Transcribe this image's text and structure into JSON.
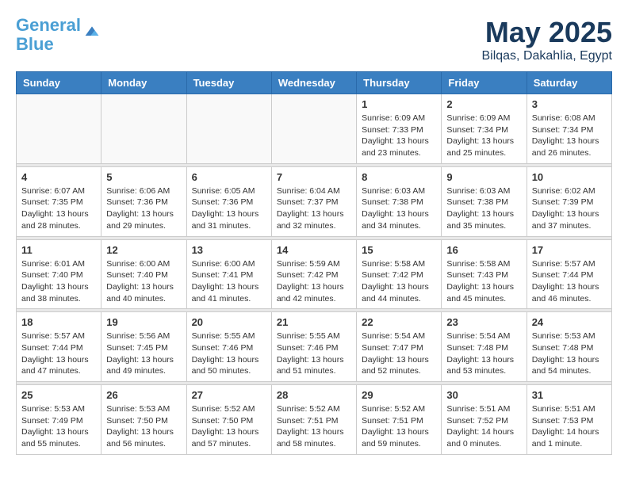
{
  "header": {
    "logo_line1": "General",
    "logo_line2": "Blue",
    "month": "May 2025",
    "location": "Bilqas, Dakahlia, Egypt"
  },
  "days_of_week": [
    "Sunday",
    "Monday",
    "Tuesday",
    "Wednesday",
    "Thursday",
    "Friday",
    "Saturday"
  ],
  "weeks": [
    [
      {
        "num": "",
        "info": ""
      },
      {
        "num": "",
        "info": ""
      },
      {
        "num": "",
        "info": ""
      },
      {
        "num": "",
        "info": ""
      },
      {
        "num": "1",
        "info": "Sunrise: 6:09 AM\nSunset: 7:33 PM\nDaylight: 13 hours\nand 23 minutes."
      },
      {
        "num": "2",
        "info": "Sunrise: 6:09 AM\nSunset: 7:34 PM\nDaylight: 13 hours\nand 25 minutes."
      },
      {
        "num": "3",
        "info": "Sunrise: 6:08 AM\nSunset: 7:34 PM\nDaylight: 13 hours\nand 26 minutes."
      }
    ],
    [
      {
        "num": "4",
        "info": "Sunrise: 6:07 AM\nSunset: 7:35 PM\nDaylight: 13 hours\nand 28 minutes."
      },
      {
        "num": "5",
        "info": "Sunrise: 6:06 AM\nSunset: 7:36 PM\nDaylight: 13 hours\nand 29 minutes."
      },
      {
        "num": "6",
        "info": "Sunrise: 6:05 AM\nSunset: 7:36 PM\nDaylight: 13 hours\nand 31 minutes."
      },
      {
        "num": "7",
        "info": "Sunrise: 6:04 AM\nSunset: 7:37 PM\nDaylight: 13 hours\nand 32 minutes."
      },
      {
        "num": "8",
        "info": "Sunrise: 6:03 AM\nSunset: 7:38 PM\nDaylight: 13 hours\nand 34 minutes."
      },
      {
        "num": "9",
        "info": "Sunrise: 6:03 AM\nSunset: 7:38 PM\nDaylight: 13 hours\nand 35 minutes."
      },
      {
        "num": "10",
        "info": "Sunrise: 6:02 AM\nSunset: 7:39 PM\nDaylight: 13 hours\nand 37 minutes."
      }
    ],
    [
      {
        "num": "11",
        "info": "Sunrise: 6:01 AM\nSunset: 7:40 PM\nDaylight: 13 hours\nand 38 minutes."
      },
      {
        "num": "12",
        "info": "Sunrise: 6:00 AM\nSunset: 7:40 PM\nDaylight: 13 hours\nand 40 minutes."
      },
      {
        "num": "13",
        "info": "Sunrise: 6:00 AM\nSunset: 7:41 PM\nDaylight: 13 hours\nand 41 minutes."
      },
      {
        "num": "14",
        "info": "Sunrise: 5:59 AM\nSunset: 7:42 PM\nDaylight: 13 hours\nand 42 minutes."
      },
      {
        "num": "15",
        "info": "Sunrise: 5:58 AM\nSunset: 7:42 PM\nDaylight: 13 hours\nand 44 minutes."
      },
      {
        "num": "16",
        "info": "Sunrise: 5:58 AM\nSunset: 7:43 PM\nDaylight: 13 hours\nand 45 minutes."
      },
      {
        "num": "17",
        "info": "Sunrise: 5:57 AM\nSunset: 7:44 PM\nDaylight: 13 hours\nand 46 minutes."
      }
    ],
    [
      {
        "num": "18",
        "info": "Sunrise: 5:57 AM\nSunset: 7:44 PM\nDaylight: 13 hours\nand 47 minutes."
      },
      {
        "num": "19",
        "info": "Sunrise: 5:56 AM\nSunset: 7:45 PM\nDaylight: 13 hours\nand 49 minutes."
      },
      {
        "num": "20",
        "info": "Sunrise: 5:55 AM\nSunset: 7:46 PM\nDaylight: 13 hours\nand 50 minutes."
      },
      {
        "num": "21",
        "info": "Sunrise: 5:55 AM\nSunset: 7:46 PM\nDaylight: 13 hours\nand 51 minutes."
      },
      {
        "num": "22",
        "info": "Sunrise: 5:54 AM\nSunset: 7:47 PM\nDaylight: 13 hours\nand 52 minutes."
      },
      {
        "num": "23",
        "info": "Sunrise: 5:54 AM\nSunset: 7:48 PM\nDaylight: 13 hours\nand 53 minutes."
      },
      {
        "num": "24",
        "info": "Sunrise: 5:53 AM\nSunset: 7:48 PM\nDaylight: 13 hours\nand 54 minutes."
      }
    ],
    [
      {
        "num": "25",
        "info": "Sunrise: 5:53 AM\nSunset: 7:49 PM\nDaylight: 13 hours\nand 55 minutes."
      },
      {
        "num": "26",
        "info": "Sunrise: 5:53 AM\nSunset: 7:50 PM\nDaylight: 13 hours\nand 56 minutes."
      },
      {
        "num": "27",
        "info": "Sunrise: 5:52 AM\nSunset: 7:50 PM\nDaylight: 13 hours\nand 57 minutes."
      },
      {
        "num": "28",
        "info": "Sunrise: 5:52 AM\nSunset: 7:51 PM\nDaylight: 13 hours\nand 58 minutes."
      },
      {
        "num": "29",
        "info": "Sunrise: 5:52 AM\nSunset: 7:51 PM\nDaylight: 13 hours\nand 59 minutes."
      },
      {
        "num": "30",
        "info": "Sunrise: 5:51 AM\nSunset: 7:52 PM\nDaylight: 14 hours\nand 0 minutes."
      },
      {
        "num": "31",
        "info": "Sunrise: 5:51 AM\nSunset: 7:53 PM\nDaylight: 14 hours\nand 1 minute."
      }
    ]
  ]
}
